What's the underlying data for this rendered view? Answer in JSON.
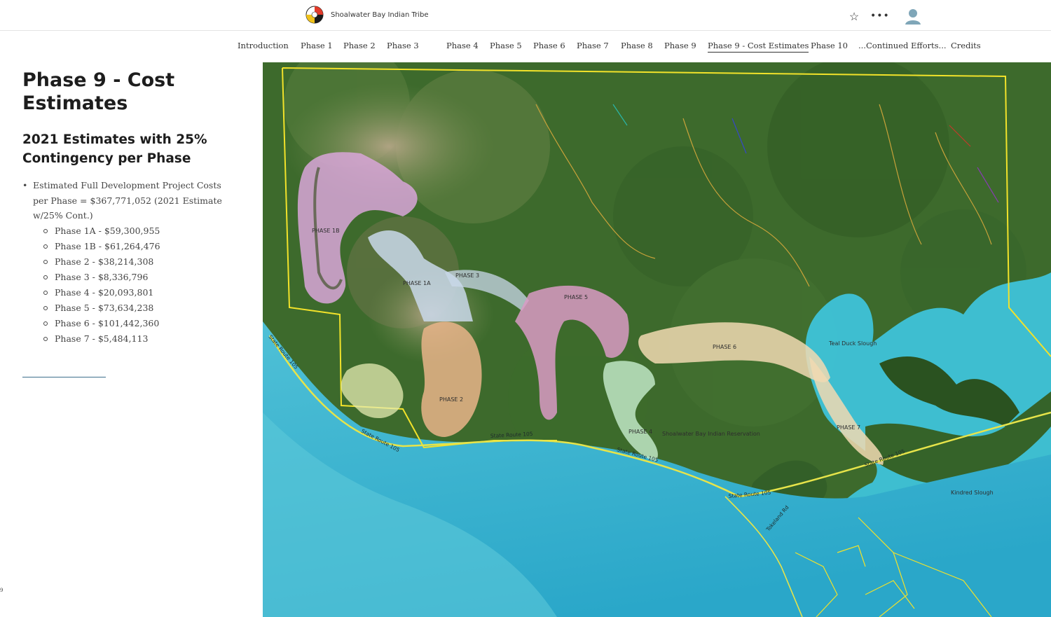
{
  "header": {
    "site_title": "Shoalwater Bay Indian Tribe",
    "icons": [
      "logo-medicine-wheel",
      "star-icon",
      "more-icon",
      "user-avatar-icon"
    ]
  },
  "nav": {
    "items": [
      {
        "label": "Introduction"
      },
      {
        "label": "Phase 1"
      },
      {
        "label": "Phase 2"
      },
      {
        "label": "Phase 3"
      },
      {
        "label": "Phase 4"
      },
      {
        "label": "Phase 5"
      },
      {
        "label": "Phase 6"
      },
      {
        "label": "Phase 7"
      },
      {
        "label": "Phase 8"
      },
      {
        "label": "Phase 9"
      },
      {
        "label": "Phase 9 - Cost Estimates"
      },
      {
        "label": "Phase 10"
      },
      {
        "label": "...Continued Efforts..."
      },
      {
        "label": "Credits"
      }
    ],
    "active": "Phase 9 - Cost Estimates"
  },
  "content": {
    "title": "Phase 9 - Cost Estimates",
    "subtitle": "2021 Estimates with 25% Contingency per Phase",
    "bullet_main": "Estimated Full Development Project Costs per Phase = $367,771,052 (2021 Estimate w/25% Cont.)",
    "costs": [
      "Phase 1A - $59,300,955",
      "Phase 1B - $61,264,476",
      "Phase 2 - $38,214,308",
      "Phase 3 - $8,336,796",
      "Phase 4 - $20,093,801",
      "Phase 5 - $73,634,238",
      "Phase 6 - $101,442,360",
      "Phase 7 - $5,484,113"
    ],
    "corner_mark": "9"
  },
  "map": {
    "phase_labels": [
      "PHASE 1B",
      "PHASE 1A",
      "PHASE 3",
      "PHASE 2",
      "PHASE 5",
      "PHASE 6",
      "PHASE 4",
      "PHASE 7"
    ],
    "road_labels": [
      "State Route 105",
      "State Route 105",
      "State Route 105",
      "State Route 105",
      "State Route 105",
      "State Route 105"
    ],
    "place_labels": [
      "Teal Duck Slough",
      "Shoalwater Bay Indian Reservation",
      "Kindred Slough",
      "Tokeland Rd"
    ],
    "colors": {
      "forest": "#3f6e2e",
      "water": "#3ec3d9",
      "ocean": "#5fc7da",
      "boundary": "#f2e22a",
      "phase_1b": "#d9a6d9",
      "phase_1a": "#c9d8ea",
      "phase_2": "#e9b48a",
      "phase_5": "#d99ac4",
      "phase_6": "#f1d9b1"
    }
  }
}
